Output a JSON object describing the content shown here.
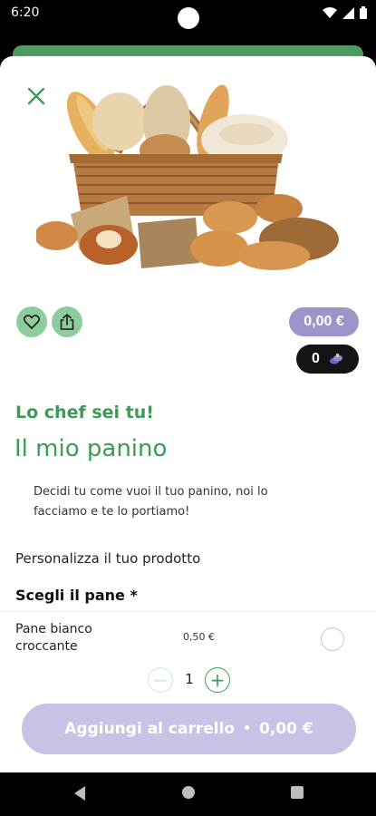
{
  "status_bar": {
    "time": "6:20"
  },
  "product": {
    "tagline": "Lo chef sei tu!",
    "title": "Il mio panino",
    "description": "Decidi tu come vuoi il tuo panino, noi lo facciamo e te lo portiamo!",
    "price": "0,00 €",
    "points": "0"
  },
  "customize": {
    "label": "Personalizza il tuo prodotto",
    "section_title": "Scegli il pane *",
    "options": [
      {
        "name": "Pane bianco croccante",
        "price": "0,50 €",
        "selected": false
      }
    ]
  },
  "stepper": {
    "value": "1",
    "minus": "−",
    "plus": "+"
  },
  "cart_button": {
    "label": "Aggiungi al carrello",
    "separator": "•",
    "total": "0,00 €"
  },
  "colors": {
    "brand_green": "#3f9a57",
    "action_green": "#8fcc9b",
    "price_purple": "#9a96cc",
    "cart_button": "#c6c3e5",
    "points_bg": "#141414"
  },
  "icons": {
    "close": "close-icon",
    "favorite": "heart-icon",
    "share": "share-icon",
    "points": "coin-icon"
  }
}
